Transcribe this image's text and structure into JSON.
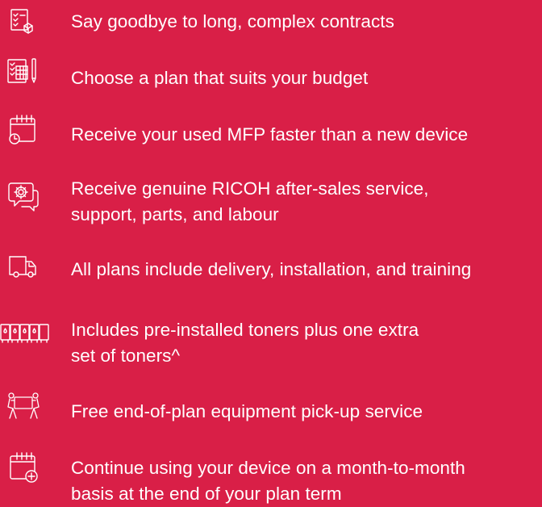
{
  "features": [
    {
      "icon": "checklist-box-icon",
      "lines": [
        "Say goodbye to long, complex contracts"
      ]
    },
    {
      "icon": "calculator-budget-icon",
      "lines": [
        "Choose a plan that suits your budget"
      ]
    },
    {
      "icon": "calendar-clock-icon",
      "lines": [
        "Receive your used MFP faster than a new device"
      ]
    },
    {
      "icon": "gear-speech-bubble-icon",
      "lines": [
        "Receive genuine RICOH after-sales service,",
        "support, parts, and labour"
      ]
    },
    {
      "icon": "delivery-truck-icon",
      "lines": [
        "All plans include delivery, installation, and training"
      ]
    },
    {
      "icon": "toner-cartridges-icon",
      "lines": [
        "Includes pre-installed toners plus one extra",
        "set of toners^"
      ]
    },
    {
      "icon": "people-carrying-box-icon",
      "lines": [
        "Free end-of-plan equipment pick-up service"
      ]
    },
    {
      "icon": "calendar-plus-icon",
      "lines": [
        "Continue using your device on a month-to-month",
        "basis at the end of your plan term"
      ]
    }
  ]
}
